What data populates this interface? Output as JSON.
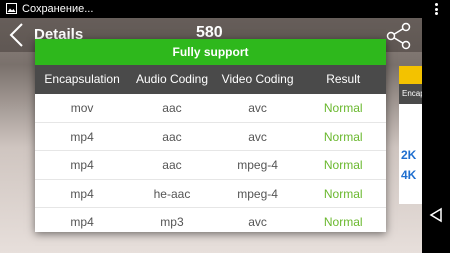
{
  "status": {
    "text": "Сохранение..."
  },
  "header": {
    "title": "Details",
    "count": "580"
  },
  "side_panel": {
    "label": "Encaps",
    "res1": "2K",
    "res2": "4K"
  },
  "dialog": {
    "title": "Fully support",
    "columns": [
      "Encapsulation",
      "Audio Coding",
      "Video Coding",
      "Result"
    ],
    "rows": [
      {
        "encapsulation": "mov",
        "audio": "aac",
        "video": "avc",
        "result": "Normal"
      },
      {
        "encapsulation": "mp4",
        "audio": "aac",
        "video": "avc",
        "result": "Normal"
      },
      {
        "encapsulation": "mp4",
        "audio": "aac",
        "video": "mpeg-4",
        "result": "Normal"
      },
      {
        "encapsulation": "mp4",
        "audio": "he-aac",
        "video": "mpeg-4",
        "result": "Normal"
      },
      {
        "encapsulation": "mp4",
        "audio": "mp3",
        "video": "avc",
        "result": "Normal"
      }
    ]
  },
  "colors": {
    "green": "#2eb81c",
    "result_green": "#6ab82e",
    "header_dark": "#4a4a4a"
  },
  "icons": {
    "image": "image-icon",
    "menu": "overflow-menu-icon",
    "back": "back-chevron-icon",
    "share": "share-icon",
    "nav_back": "nav-back-icon"
  }
}
